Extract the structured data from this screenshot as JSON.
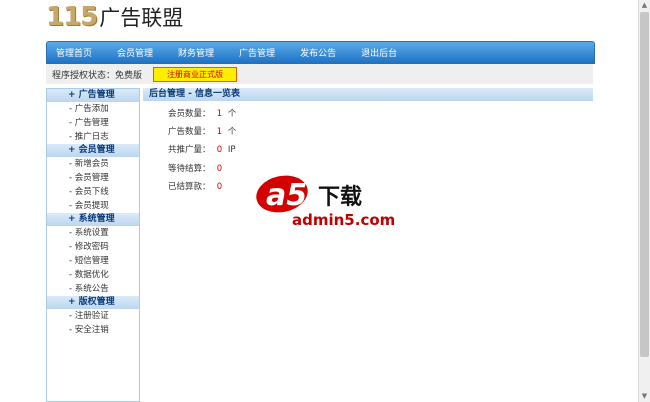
{
  "logo": {
    "number": "115",
    "text": "广告联盟"
  },
  "nav": [
    "管理首页",
    "会员管理",
    "财务管理",
    "广告管理",
    "发布公告",
    "退出后台"
  ],
  "status": {
    "label": "程序授权状态：免费版",
    "upgrade_button": "注册商业正式版"
  },
  "sidebar": [
    {
      "title": "+ 广告管理",
      "items": [
        "- 广告添加",
        "- 广告管理",
        "- 推广日志"
      ]
    },
    {
      "title": "+ 会员管理",
      "items": [
        "- 新增会员",
        "- 会员管理",
        "- 会员下线",
        "- 会员提现"
      ]
    },
    {
      "title": "+ 系统管理",
      "items": [
        "- 系统设置",
        "- 修改密码",
        "- 短信管理",
        "- 数据优化",
        "- 系统公告"
      ]
    },
    {
      "title": "+ 版权管理",
      "items": [
        "- 注册验证",
        "- 安全注销"
      ]
    }
  ],
  "main": {
    "header": "后台管理 - 信息一览表",
    "stats": [
      {
        "label": "会员数量：",
        "value": "1",
        "unit": "个"
      },
      {
        "label": "广告数量：",
        "value": "1",
        "unit": "个"
      },
      {
        "label": "共推广量：",
        "value": "0",
        "unit": "IP"
      },
      {
        "label": "等待结算：",
        "value": "0",
        "unit": ""
      },
      {
        "label": "已结算款：",
        "value": "0",
        "unit": ""
      }
    ]
  },
  "watermark": {
    "big": "a5",
    "cn": "下载",
    "url": "admin5.com"
  },
  "colors": {
    "nav_top": "#5aaae8",
    "nav_bottom": "#1f73c4",
    "value_red": "#d40000",
    "logo_gold": "#c8a86a",
    "button_yellow": "#ffee00"
  }
}
